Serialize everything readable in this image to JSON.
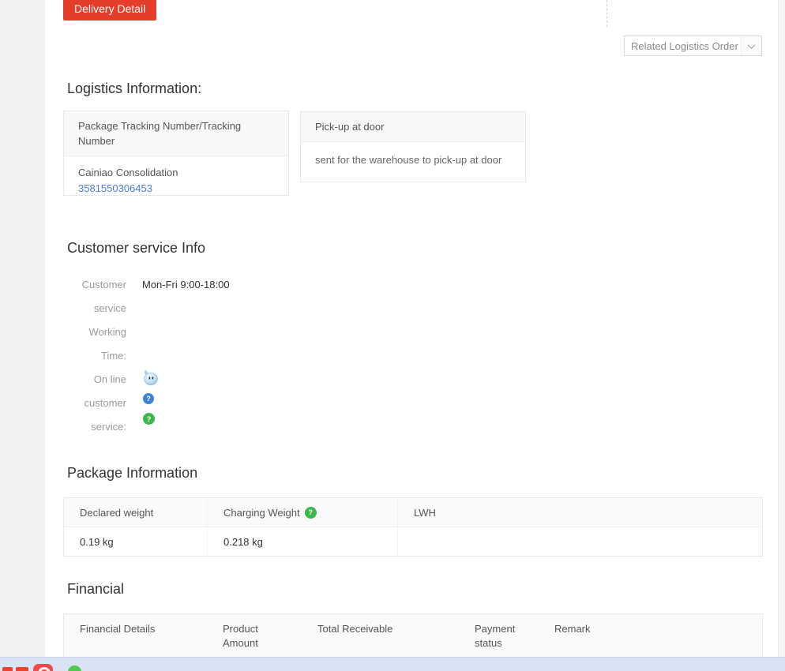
{
  "header": {
    "tab_label": "Delivery Detail",
    "related_order_dropdown": "Related Logistics Order"
  },
  "logistics": {
    "heading": "Logistics Information:",
    "tracking_card": {
      "header": "Package Tracking Number/Tracking Number",
      "carrier": "Cainiao Consolidation",
      "tracking_number": "3581550306453"
    },
    "pickup_card": {
      "header": "Pick-up at door",
      "body": "sent for the warehouse to pick-up at door"
    }
  },
  "customer_service": {
    "heading": "Customer service Info",
    "working_time": {
      "label_lines": [
        "Customer",
        "service",
        "Working",
        "Time:"
      ],
      "value": "Mon-Fri 9:00-18:00"
    },
    "online_service": {
      "label_lines": [
        "On line",
        "customer",
        "service:"
      ],
      "icons": [
        "wangwang-chat-icon",
        "help-icon-blue",
        "help-icon-green"
      ]
    }
  },
  "package": {
    "heading": "Package Information",
    "columns": [
      "Declared weight",
      "Charging Weight",
      "LWH"
    ],
    "row": [
      "0.19 kg",
      "0.218 kg",
      ""
    ]
  },
  "financial": {
    "heading": "Financial",
    "columns": [
      "Financial Details",
      "Product Amount",
      "Total Receivable",
      "Payment status",
      "Remark"
    ]
  },
  "icons": {
    "help_glyph": "?"
  },
  "colors": {
    "tab_red": "#e43e2b",
    "link_blue": "#4b7cd8",
    "help_green": "#3cb84a",
    "help_blue": "#3e82d8",
    "taskbar_blue": "#d8e3f4",
    "card_header_bg": "#f8f8f8",
    "table_header_bg": "#fafafa"
  }
}
